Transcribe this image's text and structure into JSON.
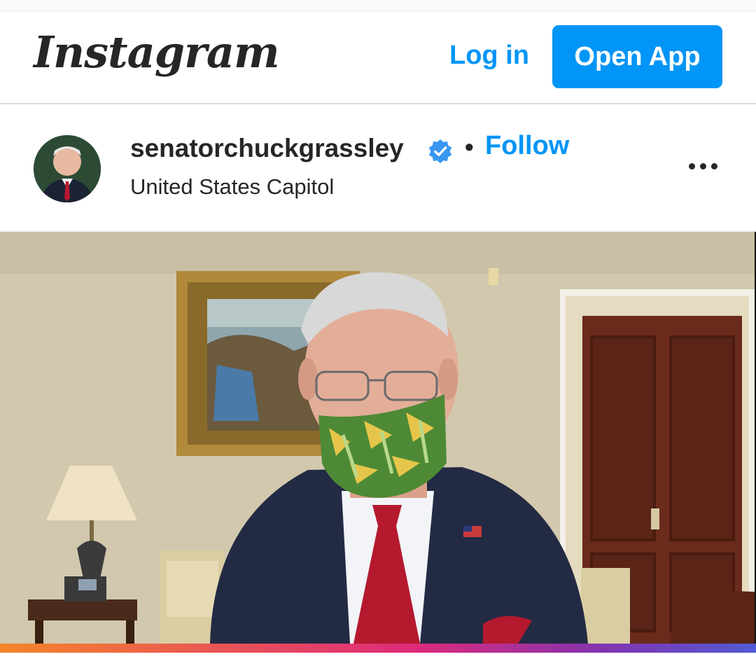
{
  "header": {
    "logo_text": "Instagram",
    "login_label": "Log in",
    "open_app_label": "Open App"
  },
  "post": {
    "username": "senatorchuckgrassley",
    "verified_icon": "verified-badge-icon",
    "separator": "•",
    "follow_label": "Follow",
    "location": "United States Capitol",
    "more_icon": "more-options-icon",
    "media": "video-frame"
  },
  "colors": {
    "accent": "#0095f6",
    "text": "#262626",
    "divider": "#dbdbdb"
  }
}
